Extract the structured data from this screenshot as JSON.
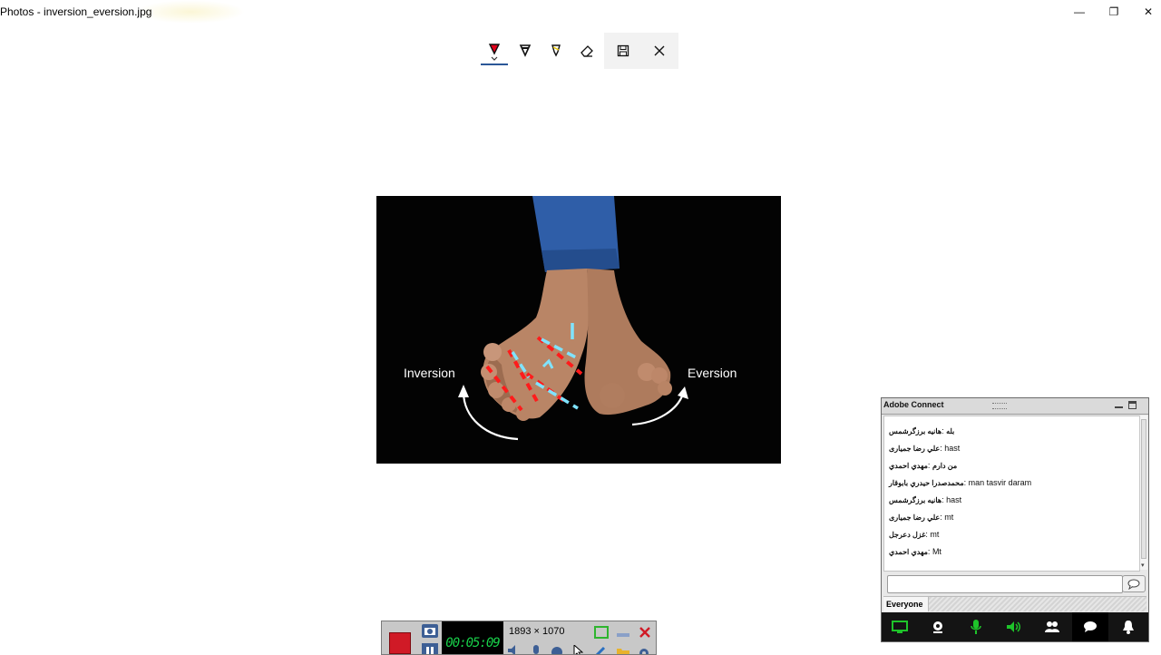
{
  "window": {
    "title": "Photos - inversion_eversion.jpg",
    "minimize": "—",
    "restore": "❐",
    "close": "✕"
  },
  "toolbar": {
    "tools": [
      "ballpoint-pen-icon",
      "pencil-icon",
      "highlighter-icon",
      "eraser-icon"
    ],
    "save_icon": "save-copy-icon",
    "close_icon": "close-icon",
    "accent": "#2b5797"
  },
  "photo": {
    "label_left": "Inversion",
    "label_right": "Eversion"
  },
  "adobe_connect": {
    "title": "Adobe Connect",
    "messages": [
      {
        "sender": "هانيه برزگرشمس",
        "text": "بله"
      },
      {
        "sender": "علي رضا جميارى",
        "text": "hast"
      },
      {
        "sender": "مهدي احمدي",
        "text": "من دارم"
      },
      {
        "sender": "محمدصدرا حيدري بابوقار",
        "text": "man tasvir daram"
      },
      {
        "sender": "هانيه برزگرشمس",
        "text": "hast"
      },
      {
        "sender": "علي رضا جميارى",
        "text": "mt"
      },
      {
        "sender": "غزل دعرجل",
        "text": "mt"
      },
      {
        "sender": "مهدي احمدي",
        "text": "Mt"
      }
    ],
    "input_value": "",
    "audience": "Everyone",
    "bottom_icons": [
      "share-screen-icon",
      "camera-icon",
      "microphone-icon",
      "speaker-icon",
      "attendees-icon",
      "chat-icon",
      "notification-icon"
    ],
    "accent": "#1ec42a"
  },
  "recorder": {
    "timer": "00:05:09",
    "dimensions": "1893 × 1070"
  }
}
